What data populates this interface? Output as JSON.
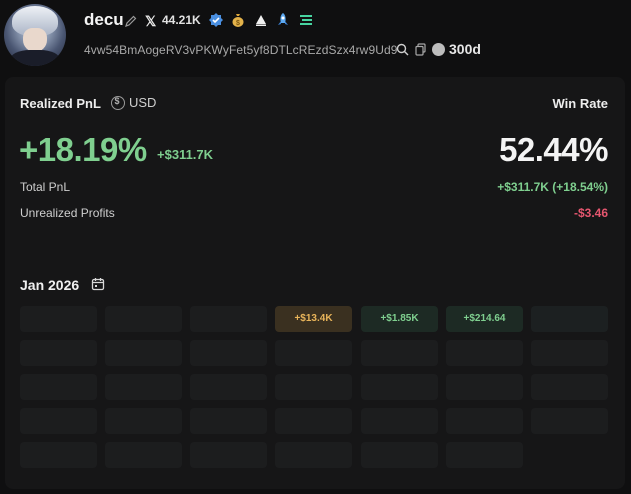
{
  "profile": {
    "name": "decu",
    "followers": "44.21K",
    "address": "4vw54BmAogeRV3vPKWyFet5yf8DTLcREzdSzx4rw9Ud9",
    "age": "300d"
  },
  "stats": {
    "realized_label": "Realized PnL",
    "currency_label": "USD",
    "winrate_label": "Win Rate",
    "realized_pct": "+18.19%",
    "realized_value": "+$311.7K",
    "winrate": "52.44%",
    "total_label": "Total PnL",
    "total_value": "+$311.7K (+18.54%)",
    "unrealized_label": "Unrealized Profits",
    "unrealized_value": "-$3.46"
  },
  "calendar": {
    "month": "Jan 2026",
    "day_values": [
      "+$13.4K",
      "+$1.85K",
      "+$214.64"
    ]
  },
  "colors": {
    "positive": "#7fcf8f",
    "negative": "#e5566f",
    "gold": "#e8b45a",
    "panel": "#161617"
  }
}
